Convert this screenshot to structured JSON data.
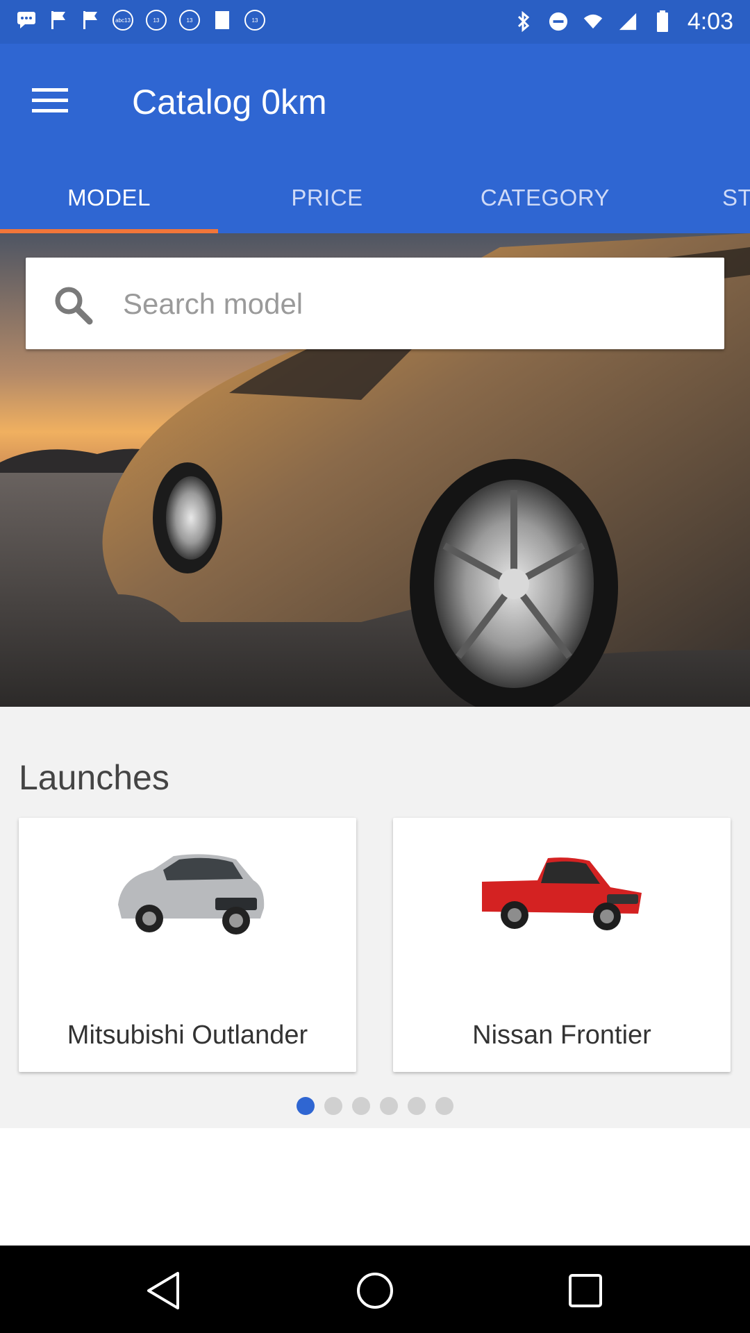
{
  "status_bar": {
    "time": "4:03",
    "icons": [
      "message-icon",
      "flag-icon",
      "flag-icon",
      "channel-icon",
      "channel-icon",
      "channel-icon",
      "square-icon",
      "channel-icon",
      "bluetooth-icon",
      "do-not-disturb-icon",
      "wifi-icon",
      "signal-icon",
      "battery-icon"
    ],
    "chip_text": "abc13"
  },
  "app_bar": {
    "title": "Catalog 0km",
    "menu_icon": "hamburger-menu-icon",
    "color": "#2f66d2"
  },
  "tabs": [
    {
      "label": "MODEL",
      "active": true
    },
    {
      "label": "PRICE",
      "active": false
    },
    {
      "label": "CATEGORY",
      "active": false
    },
    {
      "label": "ST",
      "active": false
    }
  ],
  "tab_indicator_color": "#f0763a",
  "search": {
    "placeholder": "Search model",
    "value": ""
  },
  "launches": {
    "title": "Launches",
    "cards": [
      {
        "label": "Mitsubishi Outlander",
        "image": "silver-suv-image"
      },
      {
        "label": "Nissan Frontier",
        "image": "red-pickup-image"
      }
    ],
    "pager": {
      "count": 6,
      "active_index": 0
    }
  },
  "nav_bar": {
    "icons": [
      "back-icon",
      "home-icon",
      "recents-icon"
    ]
  }
}
